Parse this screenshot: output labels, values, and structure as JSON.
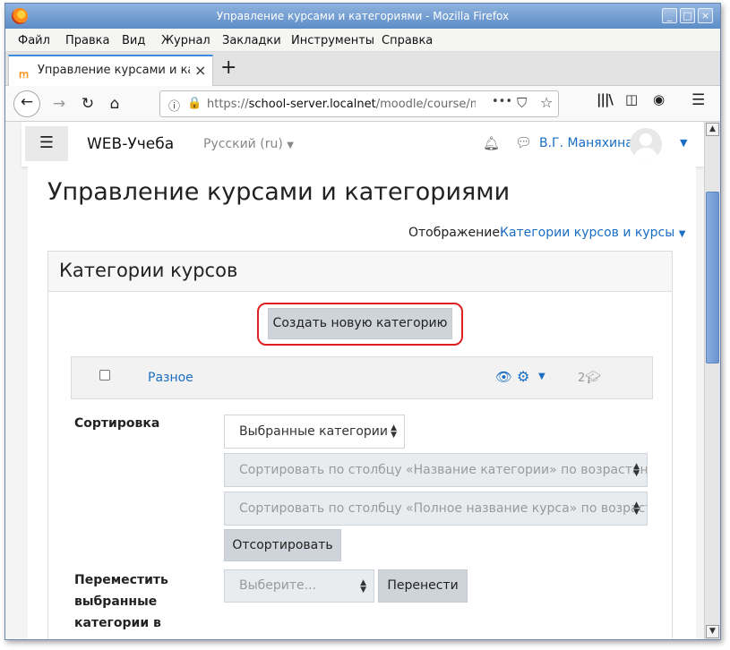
{
  "window": {
    "title": "Управление курсами и категориями - Mozilla Firefox",
    "controls": [
      "_",
      "□",
      "×"
    ]
  },
  "menu": [
    "Файл",
    "Правка",
    "Вид",
    "Журнал",
    "Закладки",
    "Инструменты",
    "Справка"
  ],
  "tab": {
    "label": "Управление курсами и кате",
    "close": "×",
    "new_tab": "+"
  },
  "navbar": {
    "url_host": "school-server.localnet",
    "url_prefix": "https://",
    "url_path": "/moodle/course/ma",
    "more": "•••"
  },
  "moodle": {
    "site_name": "WEB-Учеба",
    "language": "Русский (ru)",
    "user_name": "В.Г. Маняхина"
  },
  "page": {
    "title": "Управление курсами и категориями",
    "display_label": "Отображение:",
    "display_value": "Категории курсов и курсы"
  },
  "categories": {
    "header": "Категории курсов",
    "create_button": "Создать новую категорию",
    "items": [
      {
        "name": "Разное",
        "course_count": "2"
      }
    ]
  },
  "sort": {
    "label": "Сортировка",
    "selected": "Выбранные категории",
    "by_category_name": "Сортировать по столбцу «Название категории» по возрастанию",
    "by_course_fullname": "Сортировать по столбцу «Полное название курса» по возрастанию",
    "button": "Отсортировать"
  },
  "move": {
    "label_line1": "Переместить",
    "label_line2": "выбранные",
    "label_line3": "категории в",
    "placeholder": "Выберите...",
    "button": "Перенести"
  },
  "colors": {
    "link": "#1b6ec2",
    "highlight": "#e02020",
    "title_bar": "#5d8cc6"
  }
}
